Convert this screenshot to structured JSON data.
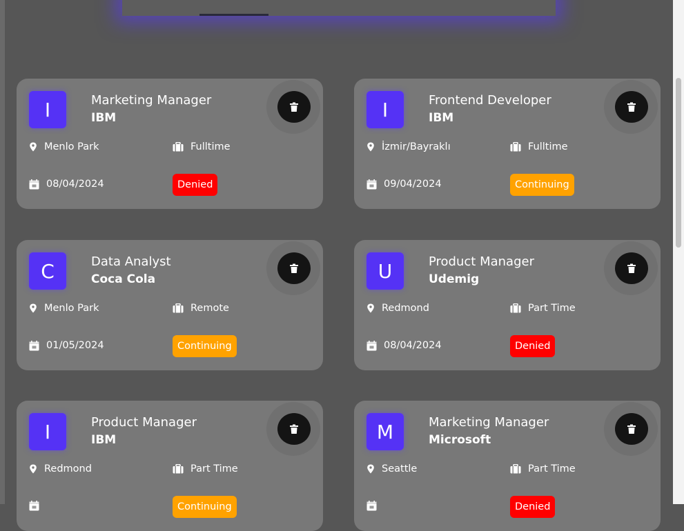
{
  "colors": {
    "page_bg": "#565656",
    "card_bg": "#787878",
    "accent": "#5532f5",
    "denied": "#ff0000",
    "continuing": "#ffa200"
  },
  "icons": {
    "location": "map-pin-icon",
    "job_type": "briefcase-icon",
    "date": "calendar-icon",
    "delete": "trash-icon"
  },
  "cards": [
    {
      "initial": "I",
      "title": "Marketing Manager",
      "company": "IBM",
      "location": "Menlo Park",
      "job_type": "Fulltime",
      "date": "08/04/2024",
      "status": "Denied",
      "status_kind": "denied"
    },
    {
      "initial": "I",
      "title": "Frontend Developer",
      "company": "IBM",
      "location": "İzmir/Bayraklı",
      "job_type": "Fulltime",
      "date": "09/04/2024",
      "status": "Continuing",
      "status_kind": "continuing"
    },
    {
      "initial": "C",
      "title": "Data Analyst",
      "company": "Coca Cola",
      "location": "Menlo Park",
      "job_type": "Remote",
      "date": "01/05/2024",
      "status": "Continuing",
      "status_kind": "continuing"
    },
    {
      "initial": "U",
      "title": "Product Manager",
      "company": "Udemig",
      "location": "Redmond",
      "job_type": "Part Time",
      "date": "08/04/2024",
      "status": "Denied",
      "status_kind": "denied"
    },
    {
      "initial": "I",
      "title": "Product Manager",
      "company": "IBM",
      "location": "Redmond",
      "job_type": "Part Time",
      "date": "",
      "status": "Continuing",
      "status_kind": "continuing"
    },
    {
      "initial": "M",
      "title": "Marketing Manager",
      "company": "Microsoft",
      "location": "Seattle",
      "job_type": "Part Time",
      "date": "",
      "status": "Denied",
      "status_kind": "denied"
    }
  ]
}
